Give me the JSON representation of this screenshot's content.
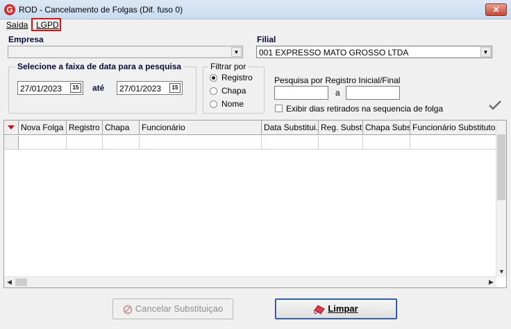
{
  "window": {
    "title": "ROD - Cancelamento de Folgas (Dif. fuso 0)",
    "app_icon_letter": "G",
    "close_symbol": "✕"
  },
  "menu": {
    "items": [
      {
        "label": "Saída"
      },
      {
        "label": "LGPD"
      }
    ]
  },
  "empresa": {
    "label": "Empresa",
    "value": ""
  },
  "filial": {
    "label": "Filial",
    "value": "001 EXPRESSO MATO GROSSO LTDA"
  },
  "date_range": {
    "title": "Selecione a faixa de data para a pesquisa",
    "start": "27/01/2023",
    "separator": "até",
    "end": "27/01/2023",
    "calendar_glyph": "15"
  },
  "filter": {
    "title": "Filtrar por",
    "options": [
      {
        "label": "Registro",
        "checked": true
      },
      {
        "label": "Chapa",
        "checked": false
      },
      {
        "label": "Nome",
        "checked": false
      }
    ]
  },
  "registro_search": {
    "label": "Pesquisa por Registro Inicial/Final",
    "separator": "a",
    "initial": "",
    "final": ""
  },
  "exibir_dias": {
    "label": "Exibir dias retirados na sequencia de folga",
    "checked": false
  },
  "grid": {
    "columns": [
      "Nova Folga",
      "Registro",
      "Chapa",
      "Funcionário",
      "Data Substitui...",
      "Reg. Subst",
      "Chapa Subst",
      "Funcionário Substituto"
    ]
  },
  "buttons": {
    "cancelar": "Cancelar Substituiçao",
    "limpar": "Limpar"
  },
  "colors": {
    "accent_red": "#e01010",
    "title_bar": "#c9dcf0"
  }
}
